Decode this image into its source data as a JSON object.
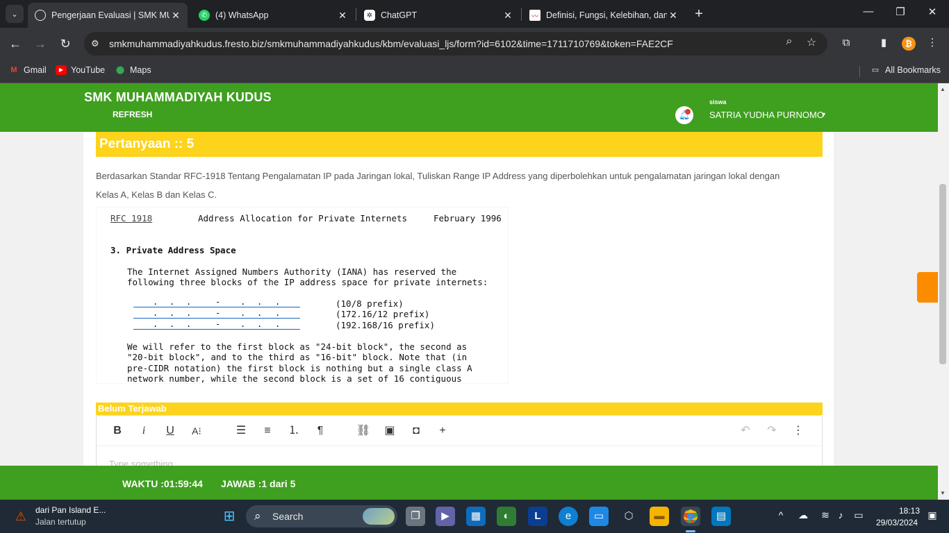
{
  "browser": {
    "tabs": [
      {
        "title": "Pengerjaan Evaluasi | SMK MUH",
        "favicon": "globe-icon"
      },
      {
        "title": "(4) WhatsApp",
        "favicon": "whatsapp-icon"
      },
      {
        "title": "ChatGPT",
        "favicon": "chatgpt-icon"
      },
      {
        "title": "Definisi, Fungsi, Kelebihan, dan",
        "favicon": "article-icon"
      }
    ],
    "url": "smkmuhammadiyahkudus.fresto.biz/smkmuhammadiyahkudus/kbm/evaluasi_ljs/form?id=6102&time=1711710769&token=FAE2CF",
    "bookmarks": [
      "Gmail",
      "YouTube",
      "Maps"
    ],
    "all_bookmarks": "All Bookmarks",
    "colors": {
      "chrome_dark": "#202124",
      "toolbar": "#35363a"
    }
  },
  "header": {
    "school_name": "SMK MUHAMMADIYAH KUDUS",
    "refresh_label": "REFRESH",
    "role": "siswa",
    "user_name": "SATRIA YUDHA PURNOMO",
    "color": "#3f9f1f"
  },
  "question": {
    "title": "Pertanyaan :: 5",
    "text_line1": "Berdasarkan Standar RFC-1918 Tentang Pengalamatan IP pada Jaringan lokal, Tuliskan Range IP Address yang diperbolehkan untuk pengalamatan jaringan lokal dengan",
    "text_line2": "Kelas A, Kelas B dan Kelas C.",
    "color": "#fdd31b"
  },
  "rfc": {
    "ref": "RFC 1918",
    "doc_title": "Address Allocation for Private Internets",
    "date": "February 1996",
    "section": "3. Private Address Space",
    "para1_line1": "The Internet Assigned Numbers Authority (IANA) has reserved the",
    "para1_line2": "following three blocks of the IP address space for private internets:",
    "prefix1": "(10/8 prefix)",
    "prefix2": "(172.16/12 prefix)",
    "prefix3": "(192.168/16 prefix)",
    "para2_line1": "We will refer to the first block as \"24-bit block\", the second as",
    "para2_line2": "\"20-bit block\", and to the third as \"16-bit\" block. Note that (in",
    "para2_line3": "pre-CIDR notation) the first block is nothing but a single class A",
    "para2_line4": "network number, while the second block is a set of 16 contiguous"
  },
  "answer": {
    "status": "Belum Terjawab",
    "placeholder": "Type something"
  },
  "footer": {
    "timer": "WAKTU :01:59:44",
    "progress": "JAWAB :1 dari 5"
  },
  "taskbar": {
    "weather_line1": "dari Pan Island E...",
    "weather_line2": "Jalan tertutup",
    "search_label": "Search",
    "time": "18:13",
    "date": "29/03/2024"
  }
}
